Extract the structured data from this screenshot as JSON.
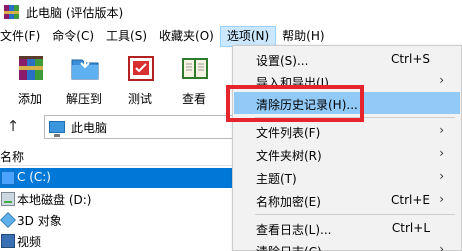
{
  "window": {
    "title": "此电脑 (评估版本)"
  },
  "menubar": [
    {
      "label": "文件(F)"
    },
    {
      "label": "命令(C)"
    },
    {
      "label": "工具(S)"
    },
    {
      "label": "收藏夹(O)"
    },
    {
      "label": "选项(N)"
    },
    {
      "label": "帮助(H)"
    }
  ],
  "toolbar": {
    "buttons": [
      {
        "label": "添加",
        "icon": "add-archive-icon"
      },
      {
        "label": "解压到",
        "icon": "extract-folder-icon"
      },
      {
        "label": "测试",
        "icon": "test-icon"
      },
      {
        "label": "查看",
        "icon": "view-book-icon"
      }
    ]
  },
  "address": {
    "path": "此电脑",
    "up_icon": "up-arrow-icon"
  },
  "file_list": {
    "column_name": "名称",
    "rows": [
      {
        "label": "C (C:)",
        "icon": "windows-drive-icon",
        "selected": true
      },
      {
        "label": "本地磁盘 (D:)",
        "icon": "drive-icon"
      },
      {
        "label": "3D 对象",
        "icon": "3d-objects-icon"
      },
      {
        "label": "视频",
        "icon": "video-folder-icon"
      }
    ]
  },
  "options_menu": {
    "items": [
      {
        "label": "设置(S)...",
        "shortcut": "Ctrl+S"
      },
      {
        "label": "导入和导出(I)",
        "submenu": "›"
      },
      {
        "label": "清除历史记录(H)...",
        "highlighted": true
      },
      {
        "label": "文件列表(F)",
        "submenu": "›"
      },
      {
        "label": "文件夹树(R)",
        "submenu": "›"
      },
      {
        "label": "主题(T)",
        "submenu": "›"
      },
      {
        "label": "名称加密(E)",
        "shortcut": "Ctrl+E",
        "submenu": "›"
      },
      {
        "label": "查看日志(L)...",
        "shortcut": "Ctrl+L"
      },
      {
        "label": "清除日志(C)",
        "submenu": "›"
      }
    ]
  },
  "colors": {
    "selection": "#0078d7",
    "menu_highlight": "#91c9f7",
    "annotation_box": "#e5242b"
  }
}
